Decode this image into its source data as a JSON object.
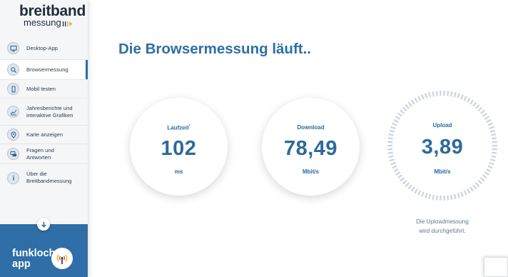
{
  "logo": {
    "top": "breitband",
    "bottom": "messung"
  },
  "nav": [
    {
      "label": "Desktop-App",
      "icon": "monitor-icon",
      "active": false
    },
    {
      "label": "Browsermessung",
      "icon": "browser-search-icon",
      "active": true
    },
    {
      "label": "Mobil testen",
      "icon": "smartphone-icon",
      "active": false
    },
    {
      "label": "Jahresberichte und interaktive Grafiken",
      "icon": "chart-icon",
      "active": false
    },
    {
      "label": "Karte anzeigen",
      "icon": "map-pin-icon",
      "active": false
    },
    {
      "label": "Fragen und Antworten",
      "icon": "chat-icon",
      "active": false
    },
    {
      "label": "Über die Breitbandmessung",
      "icon": "info-icon",
      "active": false
    }
  ],
  "footer": {
    "app_name": "funkloch-app",
    "logo_icon": "antenna-icon",
    "scroll_icon": "arrow-down-icon"
  },
  "title": "Die Browsermessung läuft..",
  "gauges": {
    "latency": {
      "label": "Laufzeit",
      "marker": "*",
      "value": "102",
      "unit": "ms"
    },
    "download": {
      "label": "Download",
      "value": "78,49",
      "unit": "Mbit/s"
    },
    "upload": {
      "label": "Upload",
      "value": "3,89",
      "unit": "Mbit/s"
    }
  },
  "upload_status": {
    "line1": "Die Uploadmessung",
    "line2": "wird durchgeführt."
  },
  "colors": {
    "accent": "#2e6ea6",
    "sidebar_footer": "#2f6ea6",
    "ring": "#c9d4de"
  }
}
